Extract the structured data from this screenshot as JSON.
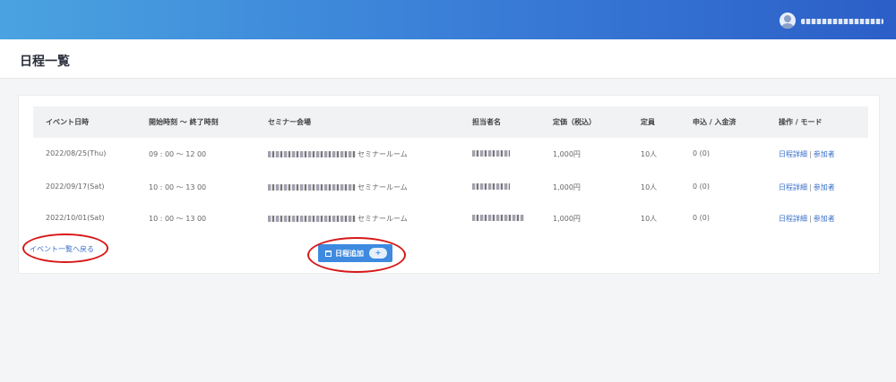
{
  "header": {
    "user_name": "user name"
  },
  "page": {
    "title": "日程一覧"
  },
  "table": {
    "columns": [
      "イベント日時",
      "開始時刻 〜 終了時刻",
      "セミナー会場",
      "担当者名",
      "定価（税込）",
      "定員",
      "申込 / 入金済",
      "操作 / モード"
    ],
    "rows": [
      {
        "date": "2022/08/25(Thu)",
        "time": "09 : 00 〜 12 00",
        "venue_suffix": "セミナールーム",
        "price": "1,000円",
        "capacity": "10人",
        "applied": "0 (0)",
        "detail_link": "日程詳細",
        "participants_link": "参加者"
      },
      {
        "date": "2022/09/17(Sat)",
        "time": "10 : 00 〜 13 00",
        "venue_suffix": "セミナールーム",
        "price": "1,000円",
        "capacity": "10人",
        "applied": "0 (0)",
        "detail_link": "日程詳細",
        "participants_link": "参加者"
      },
      {
        "date": "2022/10/01(Sat)",
        "time": "10 : 00 〜 13 00",
        "venue_suffix": "セミナールーム",
        "price": "1,000円",
        "capacity": "10人",
        "applied": "0 (0)",
        "detail_link": "日程詳細",
        "participants_link": "参加者"
      }
    ],
    "separator": "|"
  },
  "footer": {
    "back_link": "イベント一覧へ戻る",
    "add_button": "日程追加",
    "add_plus": "+"
  },
  "icons": {
    "user": "user-avatar-icon",
    "calendar": "calendar-icon",
    "plus": "plus-icon"
  },
  "colors": {
    "header_start": "#4aa3e0",
    "header_end": "#2c5fc8",
    "link": "#3a6fc8",
    "button": "#3d8ae0",
    "annotation": "#d81818"
  }
}
